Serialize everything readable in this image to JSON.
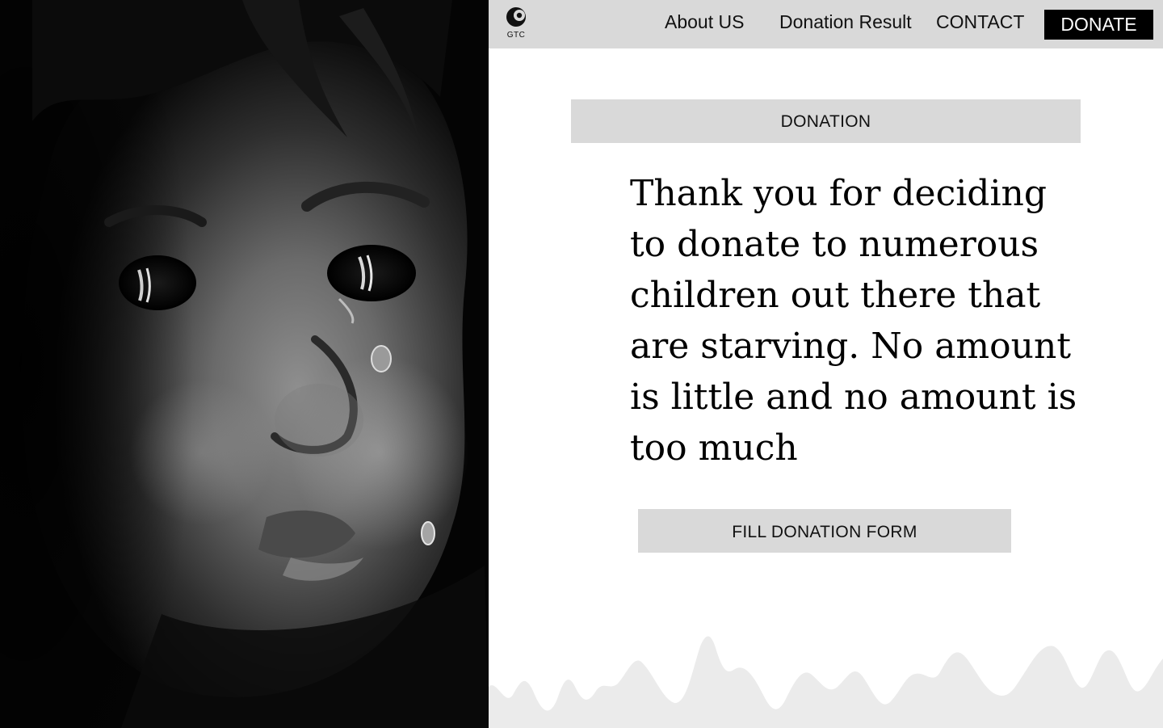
{
  "hero_image": {
    "icon": "crying-child-photo",
    "colors": {
      "background": "#050505",
      "skin_highlight": "#9a9a9a"
    }
  },
  "navbar": {
    "logo": {
      "icon": "crescent-logo-icon",
      "text": "GTC"
    },
    "links": [
      {
        "label": "About US"
      },
      {
        "label": "Donation Result"
      },
      {
        "label": "CONTACT"
      }
    ],
    "donate_label": "DONATE",
    "colors": {
      "background": "#d9d9d9",
      "donate_bg": "#000000",
      "donate_text": "#ffffff"
    }
  },
  "main": {
    "section_label": "DONATION",
    "headline": "Thank you for deciding to donate to numerous children out there that are starving. No amount is little and no amount is too much",
    "form_button_label": "FILL DONATION FORM",
    "colors": {
      "panel": "#d9d9d9",
      "text": "#000000",
      "wave": "#ebebeb"
    }
  }
}
